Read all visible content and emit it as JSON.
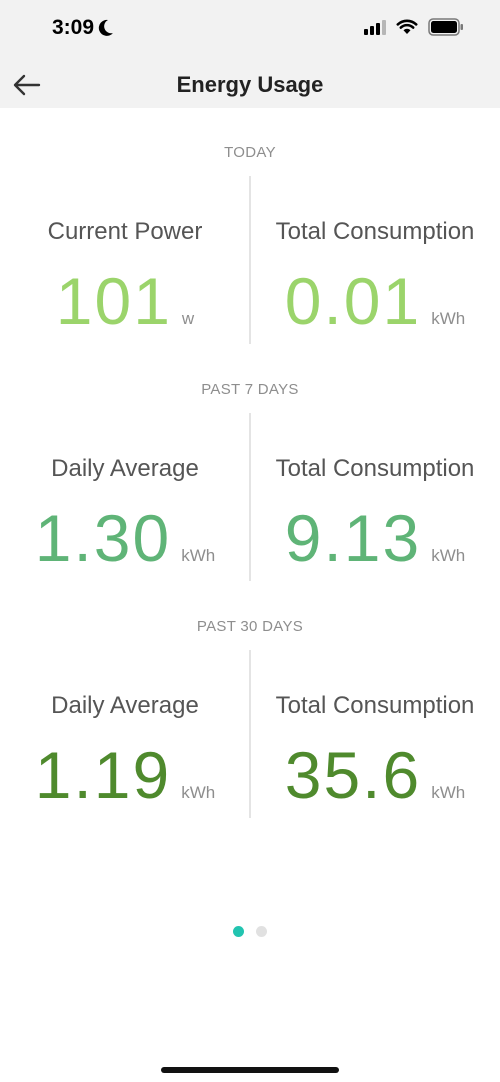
{
  "status_bar": {
    "time": "3:09",
    "moon_icon": "moon-icon",
    "signal_icon": "cellular-signal-icon",
    "wifi_icon": "wifi-icon",
    "battery_icon": "battery-icon"
  },
  "nav": {
    "back_icon": "arrow-left-icon",
    "title": "Energy Usage"
  },
  "sections": [
    {
      "header": "TODAY",
      "left": {
        "label": "Current Power",
        "value": "101",
        "unit": "w"
      },
      "right": {
        "label": "Total Consumption",
        "value": "0.01",
        "unit": "kWh"
      }
    },
    {
      "header": "PAST 7 DAYS",
      "left": {
        "label": "Daily Average",
        "value": "1.30",
        "unit": "kWh"
      },
      "right": {
        "label": "Total Consumption",
        "value": "9.13",
        "unit": "kWh"
      }
    },
    {
      "header": "PAST 30 DAYS",
      "left": {
        "label": "Daily Average",
        "value": "1.19",
        "unit": "kWh"
      },
      "right": {
        "label": "Total Consumption",
        "value": "35.6",
        "unit": "kWh"
      }
    }
  ],
  "colors": {
    "today_value": "#9bd46b",
    "past7_value": "#5fb477",
    "past30_value": "#4f8a2d",
    "page_dot_active": "#22c4b0"
  },
  "page_indicator": {
    "count": 2,
    "active": 1
  }
}
